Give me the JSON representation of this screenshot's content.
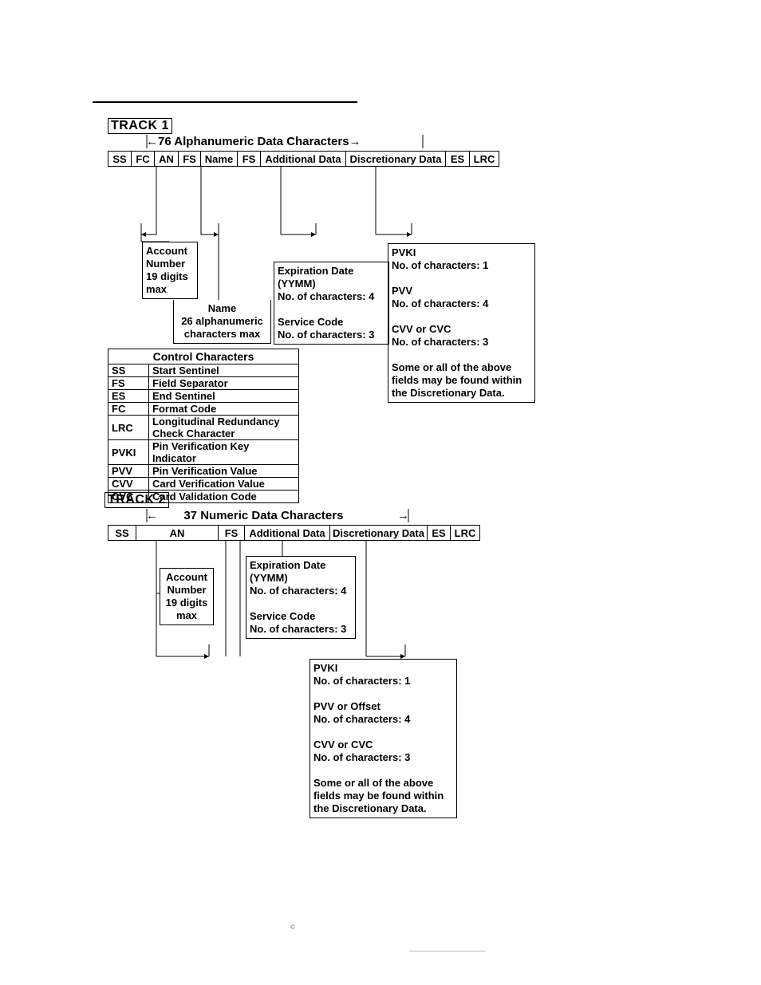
{
  "track1": {
    "label": "TRACK 1",
    "subtitle_left_arrow": "←",
    "subtitle_text": "76 Alphanumeric Data Characters",
    "subtitle_right_arrow": "→",
    "fields": {
      "ss": "SS",
      "fc": "FC",
      "an": "AN",
      "fs1": "FS",
      "name": "Name",
      "fs2": "FS",
      "add": "Additional Data",
      "disc": "Discretionary Data",
      "es": "ES",
      "lrc": "LRC"
    },
    "callouts": {
      "account": "Account\nNumber\n19 digits\nmax",
      "name": "Name\n26 alphanumeric\ncharacters max",
      "additional": "Expiration Date\n(YYMM)\nNo. of characters: 4\n\nService Code\nNo. of characters: 3",
      "disc": "PVKI\nNo. of characters: 1\n\nPVV\nNo. of characters: 4\n\nCVV or CVC\nNo. of characters: 3\n\nSome or all of the above fields may be found within the Discretionary Data."
    }
  },
  "control_characters": {
    "title": "Control Characters",
    "rows": [
      {
        "code": "SS",
        "desc": "Start Sentinel"
      },
      {
        "code": "FS",
        "desc": "Field Separator"
      },
      {
        "code": "ES",
        "desc": "End Sentinel"
      },
      {
        "code": "FC",
        "desc": "Format Code"
      },
      {
        "code": "LRC",
        "desc": "Longitudinal Redundancy Check Character"
      },
      {
        "code": "PVKI",
        "desc": "Pin Verification Key Indicator"
      },
      {
        "code": "PVV",
        "desc": "Pin Verification Value"
      },
      {
        "code": "CVV",
        "desc": "Card Verification Value"
      },
      {
        "code": "CVC",
        "desc": "Card Validation Code"
      }
    ]
  },
  "track2": {
    "label": "TRACK 2",
    "subtitle_left_arrow": "←",
    "subtitle_text": "37 Numeric Data Characters",
    "subtitle_right_arrow": "→",
    "fields": {
      "ss": "SS",
      "an": "AN",
      "fs": "FS",
      "add": "Additional Data",
      "disc": "Discretionary Data",
      "es": "ES",
      "lrc": "LRC"
    },
    "callouts": {
      "account": "Account\nNumber\n19 digits\nmax",
      "additional": "Expiration Date\n(YYMM)\nNo. of characters: 4\n\nService Code\nNo. of characters: 3",
      "disc": "PVKI\nNo. of characters: 1\n\nPVV or Offset\nNo. of characters: 4\n\nCVV or CVC\nNo. of characters: 3\n\nSome or all of the above fields may be found within the Discretionary Data."
    }
  },
  "copyright": "©"
}
